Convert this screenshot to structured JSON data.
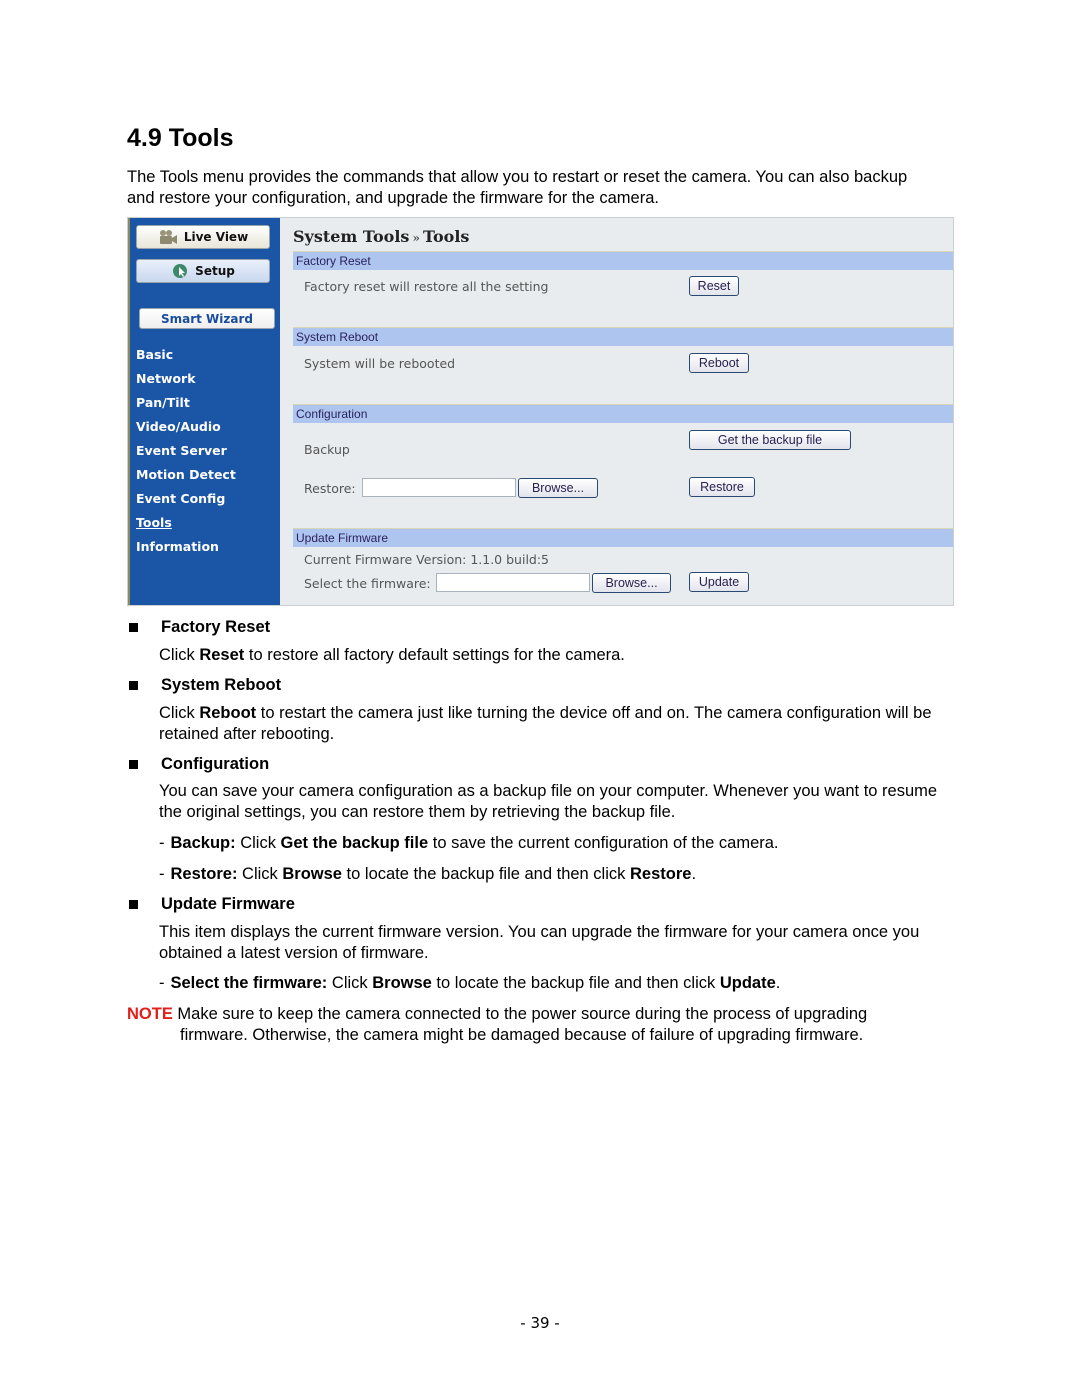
{
  "heading": "4.9  Tools",
  "intro": "The Tools menu provides the commands that allow you to restart or reset the camera. You can also backup and restore your configuration, and upgrade the firmware for the camera.",
  "screenshot": {
    "sidebar": {
      "live_view_label": "Live View",
      "setup_label": "Setup",
      "smart_wizard_label": "Smart Wizard",
      "menu_items": [
        "Basic",
        "Network",
        "Pan/Tilt",
        "Video/Audio",
        "Event Server",
        "Motion Detect",
        "Event Config",
        "Tools",
        "Information"
      ],
      "active_item": "Tools"
    },
    "page_title": {
      "parent": "System Tools",
      "separator": "»",
      "current": "Tools"
    },
    "sections": {
      "factory_reset": {
        "header": "Factory Reset",
        "description": "Factory reset will restore all the setting",
        "button": "Reset"
      },
      "system_reboot": {
        "header": "System Reboot",
        "description": "System will be rebooted",
        "button": "Reboot"
      },
      "configuration": {
        "header": "Configuration",
        "backup_label": "Backup",
        "backup_button": "Get the backup file",
        "restore_label": "Restore:",
        "restore_value": "",
        "browse_button": "Browse...",
        "restore_button": "Restore"
      },
      "update_firmware": {
        "header": "Update Firmware",
        "version_text": "Current Firmware Version: 1.1.0 build:5",
        "select_label": "Select the firmware:",
        "select_value": "",
        "browse_button": "Browse...",
        "update_button": "Update"
      }
    },
    "colors": {
      "sidebar_bg": "#1a55a6",
      "section_header_bg": "#adc5ef",
      "panel_bg": "#e8ecef"
    }
  },
  "body": {
    "factory_reset": {
      "title": "Factory Reset",
      "text_pre": "Click ",
      "text_bold": "Reset",
      "text_post": " to restore all factory default settings for the camera."
    },
    "system_reboot": {
      "title": "System Reboot",
      "text_pre": "Click ",
      "text_bold": "Reboot",
      "text_post": " to restart the camera just like turning the device off and on. The camera configuration will be retained after rebooting."
    },
    "configuration": {
      "title": "Configuration",
      "text": "You can save your camera configuration as a backup file on your computer. Whenever you want to resume the original settings, you can restore them by retrieving the backup file.",
      "backup": {
        "label": "Backup:",
        "t1": " Click ",
        "b1": "Get the backup file",
        "t2": " to save the current configuration of the camera."
      },
      "restore": {
        "label": "Restore:",
        "t1": " Click ",
        "b1": "Browse",
        "t2": " to locate the backup file and then click ",
        "b2": "Restore",
        "t3": "."
      }
    },
    "update_firmware": {
      "title": "Update Firmware",
      "text": "This item displays the current firmware version. You can upgrade the firmware for your camera once you obtained a latest version of firmware.",
      "select": {
        "label": "Select the firmware:",
        "t1": " Click ",
        "b1": "Browse",
        "t2": " to locate the backup file and then click ",
        "b2": "Update",
        "t3": "."
      }
    },
    "note": {
      "label": "NOTE",
      "line1": " Make sure to keep the camera connected to the power source during the process of upgrading",
      "line2": "firmware. Otherwise, the camera might be damaged because of failure of upgrading firmware."
    }
  },
  "page_number": "- 39 -",
  "dash": "-"
}
